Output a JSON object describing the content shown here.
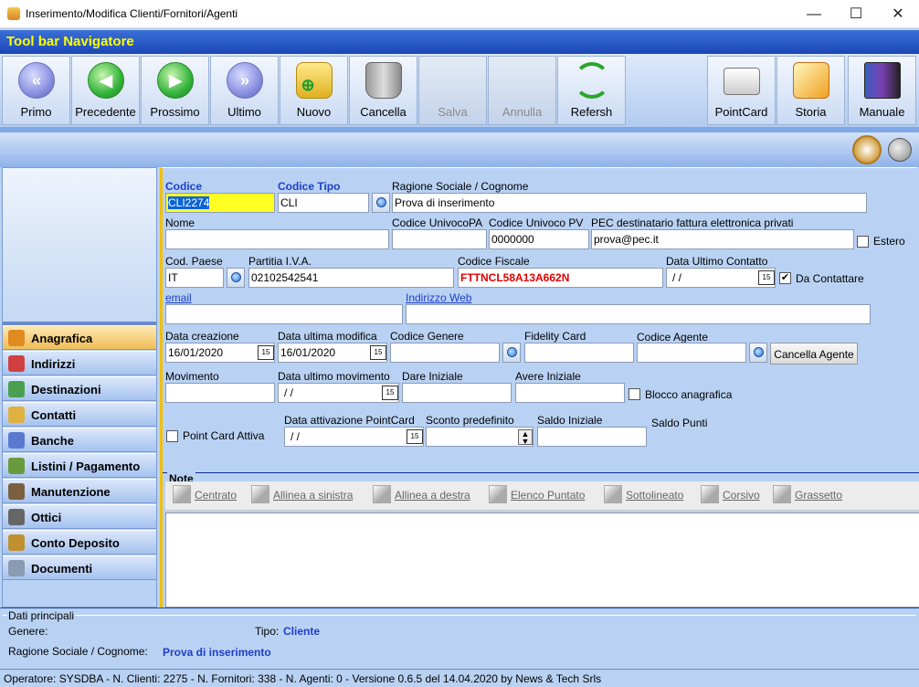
{
  "window": {
    "title": "Inserimento/Modifica Clienti/Fornitori/Agenti",
    "minimize": "—",
    "maximize": "☐",
    "close": "✕"
  },
  "toolbar": {
    "title": "Tool bar Navigatore",
    "buttons": [
      "Primo",
      "Precedente",
      "Prossimo",
      "Ultimo",
      "Nuovo",
      "Cancella",
      "Salva",
      "Annulla",
      "Refersh",
      "PointCard",
      "Storia",
      "Manuale"
    ]
  },
  "sidebar": {
    "items": [
      "Anagrafica",
      "Indirizzi",
      "Destinazioni",
      "Contatti",
      "Banche",
      "Listini / Pagamento",
      "Manutenzione",
      "Ottici",
      "Conto Deposito",
      "Documenti"
    ]
  },
  "form": {
    "codice_label": "Codice",
    "codice_value": "CLI2274",
    "codice_tipo_label": "Codice Tipo",
    "codice_tipo_value": "CLI",
    "ragione_label": "Ragione Sociale / Cognome",
    "ragione_value": "Prova di inserimento",
    "nome_label": "Nome",
    "nome_value": "",
    "cod_univ_pa_label": "Codice UnivocoPA",
    "cod_univ_pa_value": "",
    "cod_univ_pv_label": "Codice Univoco PV",
    "cod_univ_pv_value": "0000000",
    "pec_label": "PEC destinatario fattura elettronica privati",
    "pec_value": "prova@pec.it",
    "estero_label": "Estero",
    "cod_paese_label": "Cod. Paese",
    "cod_paese_value": "IT",
    "piva_label": "Partitia I.V.A.",
    "piva_value": "02102542541",
    "cf_label": "Codice Fiscale",
    "cf_value": "FTTNCL58A13A662N",
    "data_contatto_label": "Data Ultimo Contatto",
    "data_contatto_value": " /  /",
    "da_contattare_label": "Da Contattare",
    "email_label": "email",
    "web_label": "Indirizzo Web",
    "data_creazione_label": "Data creazione",
    "data_creazione_value": "16/01/2020",
    "data_modifica_label": "Data ultima modifica",
    "data_modifica_value": "16/01/2020",
    "codice_genere_label": "Codice Genere",
    "fidelity_label": "Fidelity Card",
    "codice_agente_label": "Codice Agente",
    "cancella_agente": "Cancella Agente",
    "movimento_label": "Movimento",
    "data_mov_label": "Data ultimo movimento",
    "data_mov_value": " /  /",
    "dare_label": "Dare Iniziale",
    "avere_label": "Avere Iniziale",
    "blocco_label": "Blocco anagrafica",
    "pointcard_attiva_label": "Point Card Attiva",
    "data_att_pc_label": "Data attivazione PointCard",
    "data_att_pc_value": " /  /",
    "sconto_label": "Sconto predefinito",
    "saldo_iniziale_label": "Saldo Iniziale",
    "saldo_punti_label": "Saldo Punti",
    "cal_glyph": "15",
    "check_glyph": "✔"
  },
  "note": {
    "title": "Note",
    "tools": [
      "Centrato",
      "Allinea a sinistra",
      "Allinea a destra",
      "Elenco Puntato",
      "Sottolineato",
      "Corsivo",
      "Grassetto"
    ]
  },
  "summary": {
    "title": "Dati principali",
    "genere_label": "Genere:",
    "tipo_label": "Tipo:",
    "tipo_value": "Cliente",
    "ragione_label": "Ragione Sociale / Cognome:",
    "ragione_value": "Prova di inserimento"
  },
  "statusbar": "Operatore: SYSDBA - N. Clienti: 2275 - N. Fornitori: 338 - N. Agenti: 0 - Versione 0.6.5 del 14.04.2020 by News & Tech Srls"
}
